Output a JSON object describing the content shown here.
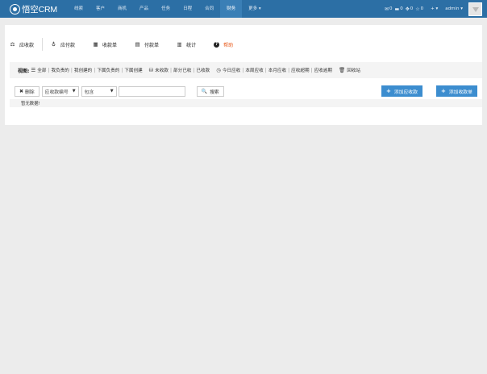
{
  "topbar": {
    "logo_text": "悟空CRM",
    "nav": [
      {
        "label": "线索",
        "active": false
      },
      {
        "label": "客户",
        "active": false
      },
      {
        "label": "商机",
        "active": false
      },
      {
        "label": "产品",
        "active": false
      },
      {
        "label": "任务",
        "active": false
      },
      {
        "label": "日程",
        "active": false
      },
      {
        "label": "合同",
        "active": false
      },
      {
        "label": "财务",
        "active": true
      },
      {
        "label": "更多",
        "active": false
      }
    ],
    "counters": [
      {
        "icon": "envelope-icon",
        "value": "0"
      },
      {
        "icon": "comment-icon",
        "value": "0"
      },
      {
        "icon": "gear-icon",
        "value": "0"
      },
      {
        "icon": "star-icon",
        "value": "0"
      }
    ],
    "add_label": "+",
    "user_name": "admin"
  },
  "actions": [
    {
      "label": "应收款",
      "icon": "receivable-icon"
    },
    {
      "label": "应付款",
      "icon": "payable-icon"
    },
    {
      "label": "收款单",
      "icon": "receipt-icon"
    },
    {
      "label": "付款单",
      "icon": "payment-icon"
    },
    {
      "label": "统计",
      "icon": "chart-icon"
    },
    {
      "label": "帮助",
      "icon": "question-icon"
    }
  ],
  "filter": {
    "label": "视图:",
    "groups": [
      {
        "icon": "list-icon",
        "items": [
          "全部",
          "我负责的",
          "我创建的",
          "下属负责的",
          "下属创建"
        ]
      },
      {
        "icon": "coins-icon",
        "items": [
          "未收款",
          "部分已收",
          "已收款"
        ]
      },
      {
        "icon": "clock-icon",
        "items": [
          "今日应收",
          "本周应收",
          "本月应收",
          "应收超期",
          "应收逾期"
        ]
      },
      {
        "icon": "trash-icon",
        "items": [
          "回收站"
        ]
      }
    ]
  },
  "toolbar": {
    "delete_label": "删除",
    "field_select": "应收款编号",
    "op_select": "包含",
    "search_value": "",
    "search_label": "搜索",
    "add_receivable_label": "添加应收款",
    "add_receipt_label": "添加收款单"
  },
  "table": {
    "empty_text": "暂无数据!"
  },
  "colors": {
    "topbar": "#2c6fa5",
    "topbar_active": "#3a7fb6",
    "primary": "#3c8dcf",
    "help": "#e85a1c",
    "page_bg": "#ececec"
  }
}
